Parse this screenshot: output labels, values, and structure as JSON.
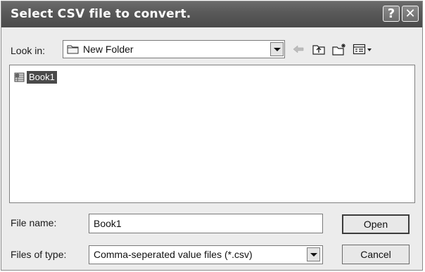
{
  "window": {
    "title": "Select CSV file to convert.",
    "help_glyph": "?",
    "close_glyph": "✕"
  },
  "lookin": {
    "label": "Look in:",
    "value": "New Folder",
    "icon": "folder-icon"
  },
  "toolbar": {
    "icons": [
      "back-arrow-icon",
      "up-folder-icon",
      "new-folder-icon",
      "view-menu-icon"
    ]
  },
  "files": [
    {
      "name": "Book1",
      "icon": "csv-file-icon",
      "selected": true
    }
  ],
  "filename": {
    "label": "File name:",
    "value": "Book1"
  },
  "filetype": {
    "label": "Files of type:",
    "value": "Comma-seperated value files (*.csv)"
  },
  "buttons": {
    "open": "Open",
    "cancel": "Cancel"
  },
  "colors": {
    "titlebar": "#5a5a5a",
    "dialog_bg": "#ececec",
    "selection": "#4a4a4a"
  }
}
